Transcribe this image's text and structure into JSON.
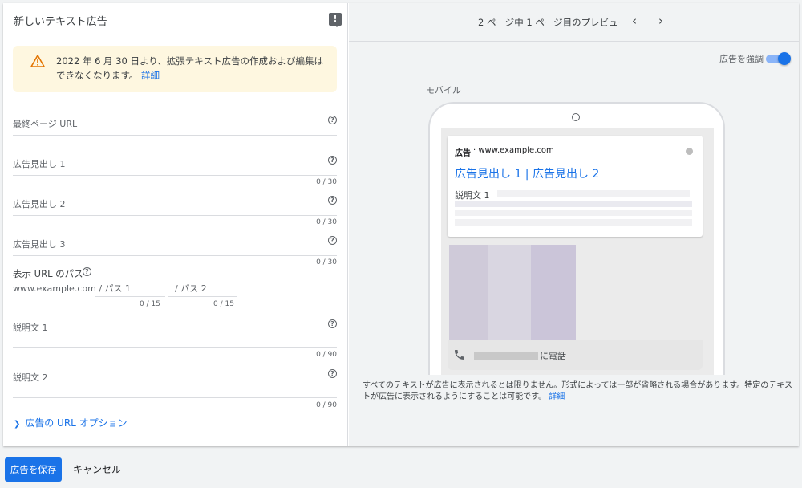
{
  "editor": {
    "title": "新しいテキスト広告",
    "fab_icon": "feedback-icon",
    "warning": {
      "text": "2022 年 6 月 30 日より、拡張テキスト広告の作成および編集はできなくなります。",
      "link": "詳細"
    },
    "fields": [
      {
        "label": "最終ページ URL",
        "counter": ""
      },
      {
        "label": "広告見出し 1",
        "counter": "0 / 30"
      },
      {
        "label": "広告見出し 2",
        "counter": "0 / 30"
      },
      {
        "label": "広告見出し 3",
        "counter": "0 / 30"
      }
    ],
    "display_path": {
      "label": "表示 URL のパス",
      "domain": "www.example.com",
      "sep1": "/ パス 1",
      "sep2": "/ パス 2",
      "counter1": "0 / 15",
      "counter2": "0 / 15"
    },
    "descriptions": [
      {
        "label": "説明文 1",
        "counter": "0 / 90"
      },
      {
        "label": "説明文 2",
        "counter": "0 / 90"
      }
    ],
    "url_options": "広告の URL オプション"
  },
  "preview": {
    "page_label": "2 ページ中 1 ページ目のプレビュー",
    "emphasize_label": "広告を強調",
    "emphasize_on": true,
    "device_label": "モバイル",
    "ad": {
      "badge": "広告",
      "domain": "www.example.com",
      "headline": "広告見出し 1 | 広告見出し 2",
      "description": "説明文 1",
      "call_text": "に電話"
    },
    "disclaimer": "すべてのテキストが広告に表示されるとは限りません。形式によっては一部が省略される場合があります。特定のテキストが広告に表示されるようにすることは可能です。",
    "disclaimer_link": "詳細"
  },
  "footer": {
    "save": "広告を保存",
    "cancel": "キャンセル"
  },
  "colors": {
    "accent": "#1a73e8",
    "warning_bg": "#fef7e0",
    "warning_icon": "#e37400"
  }
}
